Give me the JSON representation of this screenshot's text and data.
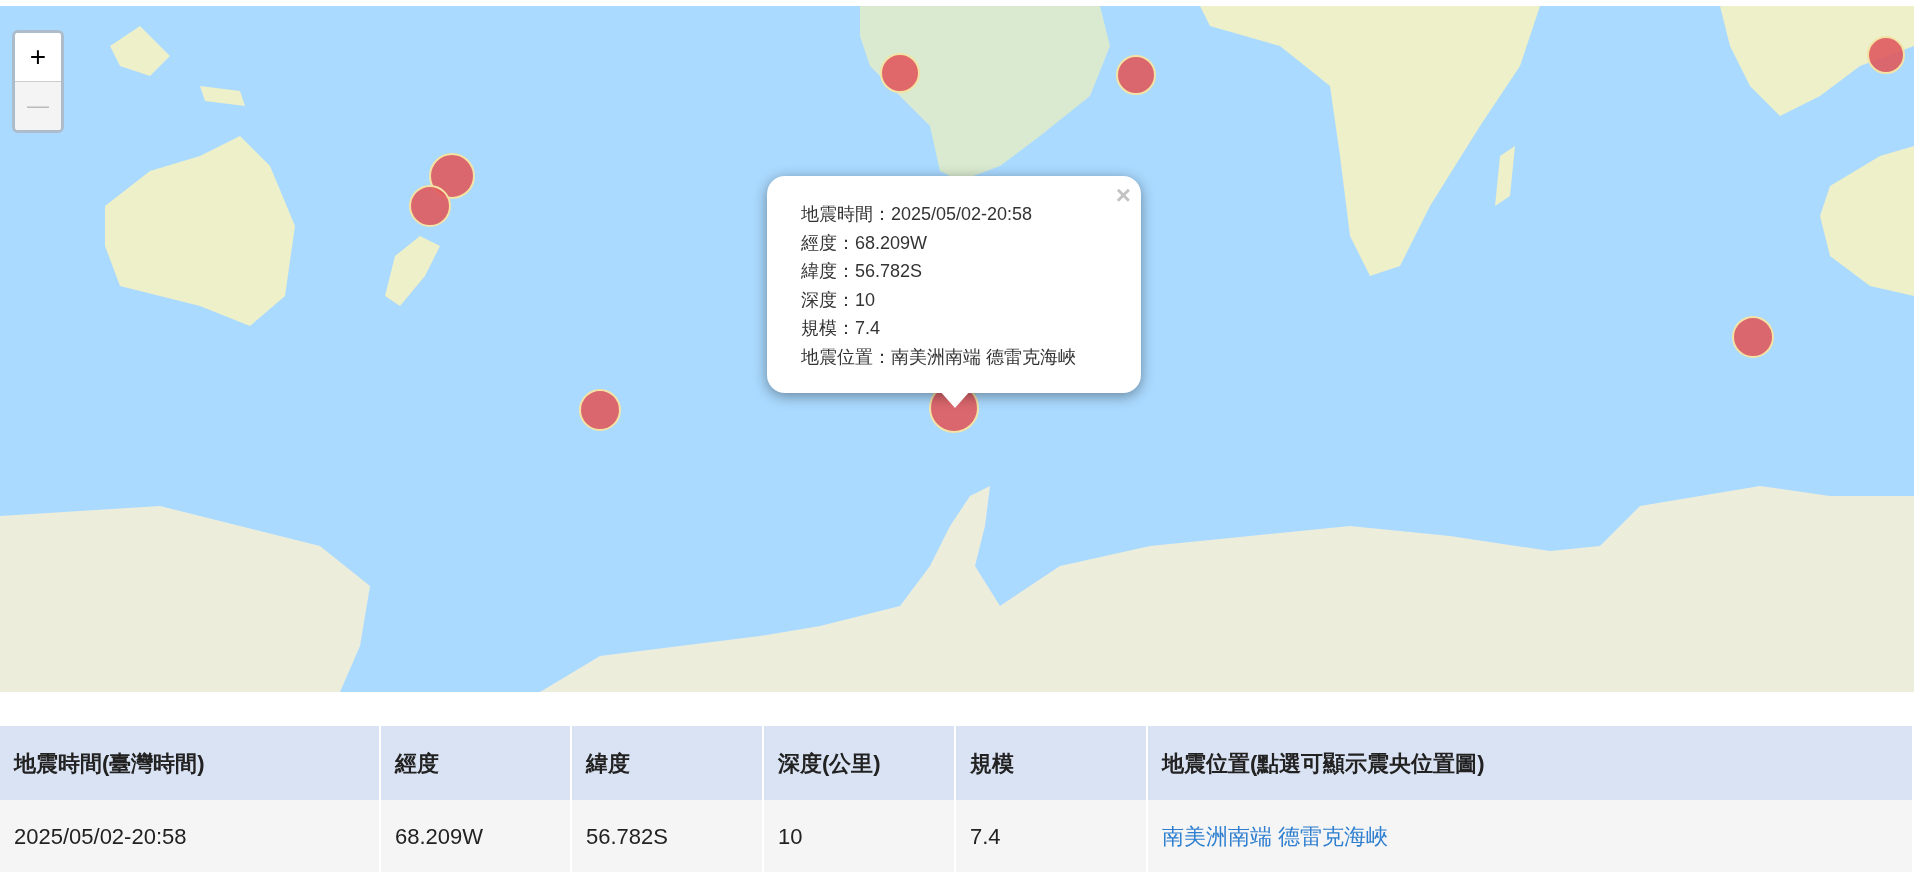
{
  "map": {
    "zoom_in": {
      "label": "+",
      "disabled": false
    },
    "zoom_out": {
      "label": "—",
      "disabled": true
    },
    "popup": {
      "close": "×",
      "lines": [
        "地震時間：2025/05/02-20:58",
        "經度：68.209W",
        "緯度：56.782S",
        "深度：10",
        "規模：7.4",
        "地震位置：南美洲南端 德雷克海峽"
      ]
    }
  },
  "table": {
    "columns": [
      "地震時間(臺灣時間)",
      "經度",
      "緯度",
      "深度(公里)",
      "規模",
      "地震位置(點選可顯示震央位置圖)"
    ],
    "rows": [
      {
        "time": "2025/05/02-20:58",
        "longitude": "68.209W",
        "latitude": "56.782S",
        "depth": "10",
        "magnitude": "7.4",
        "location": "南美洲南端 德雷克海峽"
      }
    ]
  }
}
